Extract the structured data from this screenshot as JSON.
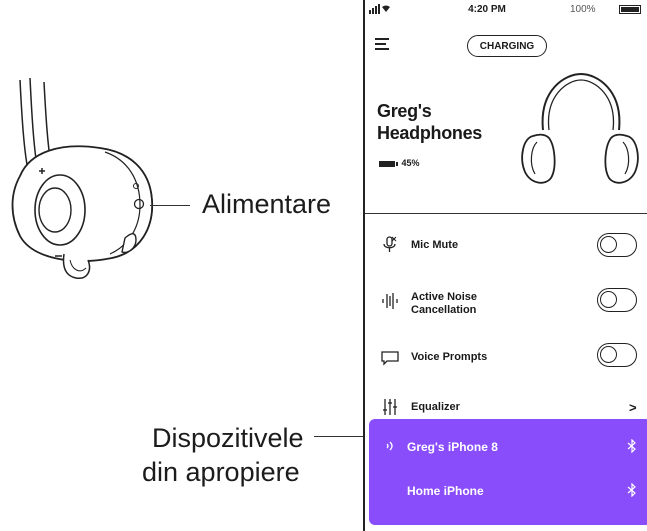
{
  "callouts": {
    "power": "Alimentare",
    "nearby_line1": "Dispozitivele",
    "nearby_line2": "din apropiere"
  },
  "phone": {
    "status_bar": {
      "time": "4:20 PM",
      "battery": "100%"
    },
    "charging_label": "CHARGING",
    "device": {
      "name_line1": "Greg's",
      "name_line2": "Headphones",
      "battery": "45%"
    },
    "settings": [
      {
        "label": "Mic Mute",
        "icon": "mic-mute-icon",
        "control": "toggle",
        "on": false
      },
      {
        "label_line1": "Active Noise",
        "label_line2": "Cancellation",
        "icon": "noise-cancellation-icon",
        "control": "toggle",
        "on": false
      },
      {
        "label": "Voice Prompts",
        "icon": "speech-bubble-icon",
        "control": "toggle",
        "on": false
      },
      {
        "label": "Equalizer",
        "icon": "equalizer-icon",
        "control": "chevron",
        "chevron": ">"
      }
    ],
    "nearby_devices": [
      {
        "name": "Greg's iPhone 8",
        "icon": "bluetooth-icon",
        "active": true
      },
      {
        "name": "Home iPhone",
        "icon": "bluetooth-icon",
        "active": false
      }
    ],
    "colors": {
      "accent": "#8a4dfb",
      "line": "#222222"
    }
  }
}
